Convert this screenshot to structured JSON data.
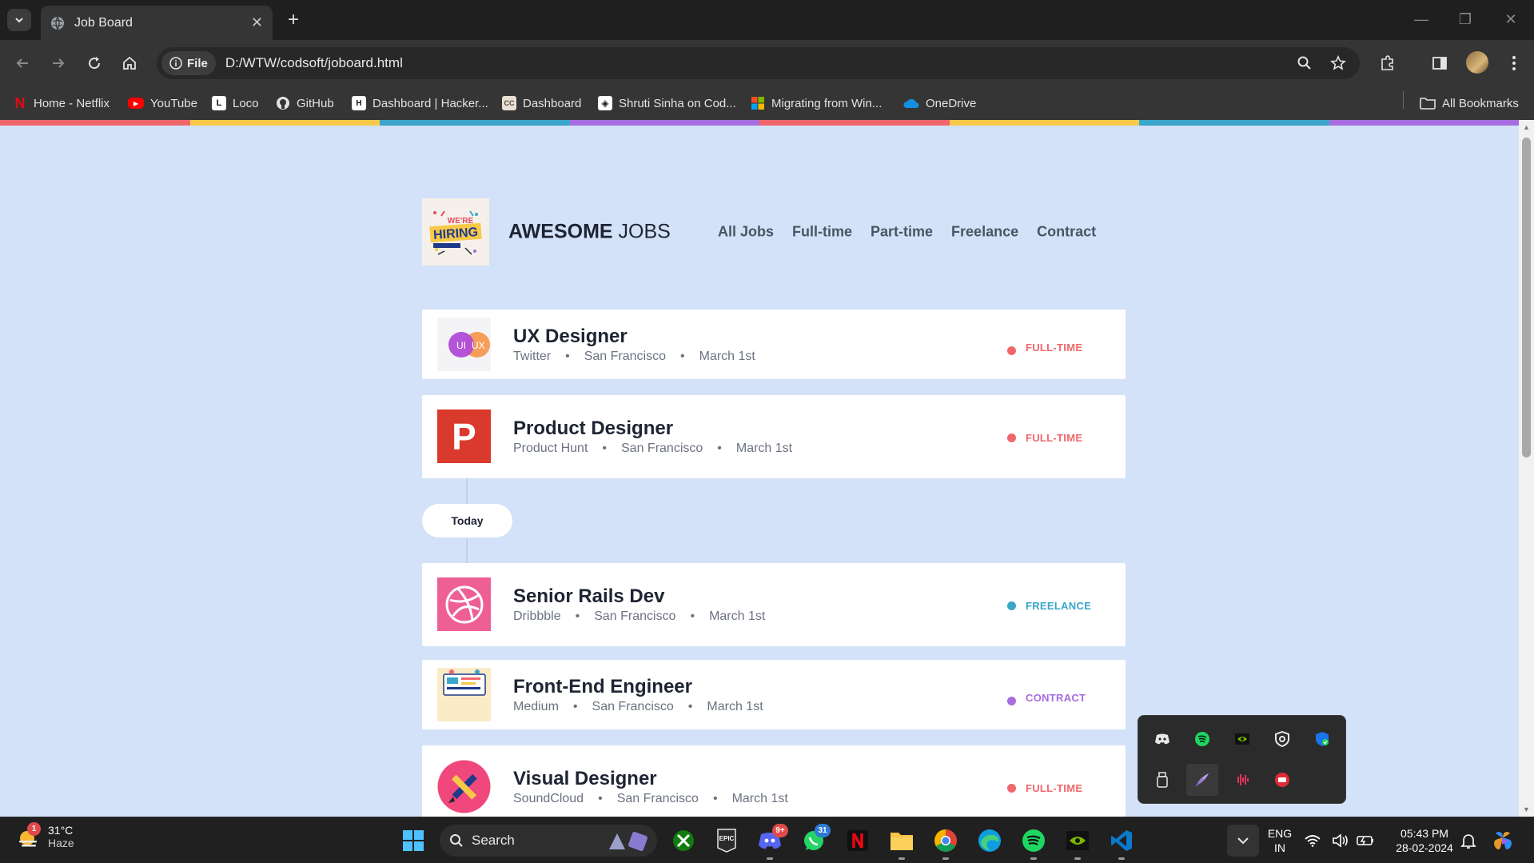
{
  "browser": {
    "tab_title": "Job Board",
    "url_chip": "File",
    "url": "D:/WTW/codsoft/joboard.html",
    "bookmarks": [
      {
        "label": "Home - Netflix",
        "icon": "netflix-icon"
      },
      {
        "label": "YouTube",
        "icon": "youtube-icon"
      },
      {
        "label": "Loco",
        "icon": "loco-icon"
      },
      {
        "label": "GitHub",
        "icon": "github-icon"
      },
      {
        "label": "Dashboard | Hacker...",
        "icon": "hackerrank-icon"
      },
      {
        "label": "Dashboard",
        "icon": "codechef-icon"
      },
      {
        "label": "Shruti Sinha on Cod...",
        "icon": "codepen-icon"
      },
      {
        "label": "Migrating from Win...",
        "icon": "microsoft-icon"
      },
      {
        "label": "OneDrive",
        "icon": "onedrive-icon"
      }
    ],
    "all_bookmarks": "All Bookmarks"
  },
  "site": {
    "brand_bold": "AWESOME",
    "brand_rest": " JOBS",
    "logo_text_top": "WE'RE",
    "logo_text_main": "HIRING",
    "nav": [
      "All Jobs",
      "Full-time",
      "Part-time",
      "Freelance",
      "Contract"
    ],
    "today_label": "Today"
  },
  "jobs": [
    {
      "title": "UX Designer",
      "company": "Twitter",
      "location": "San Francisco",
      "date": "March 1st",
      "type": "FULL-TIME",
      "type_color": "#f0676b",
      "logo_text_a": "UI",
      "logo_text_b": "UX"
    },
    {
      "title": "Product Designer",
      "company": "Product Hunt",
      "location": "San Francisco",
      "date": "March 1st",
      "type": "FULL-TIME",
      "type_color": "#f0676b",
      "logo_text": "P"
    },
    {
      "title": "Senior Rails Dev",
      "company": "Dribbble",
      "location": "San Francisco",
      "date": "March 1st",
      "type": "FREELANCE",
      "type_color": "#3aa6c9"
    },
    {
      "title": "Front-End Engineer",
      "company": "Medium",
      "location": "San Francisco",
      "date": "March 1st",
      "type": "CONTRACT",
      "type_color": "#a66ce0"
    },
    {
      "title": "Visual Designer",
      "company": "SoundCloud",
      "location": "San Francisco",
      "date": "March 1st",
      "type": "FULL-TIME",
      "type_color": "#f0676b"
    }
  ],
  "separator": "•",
  "taskbar": {
    "temperature": "31°C",
    "condition": "Haze",
    "weather_badge": "1",
    "search_label": "Search",
    "discord_badge": "9+",
    "whatsapp_badge": "31",
    "lang_top": "ENG",
    "lang_bottom": "IN",
    "time": "05:43 PM",
    "date": "28-02-2024"
  },
  "colors": {
    "page_bg": "#d3e2f8",
    "rainbow": [
      "#f0676b",
      "#f7c948",
      "#3aa6c9",
      "#a66ce0",
      "#f0676b",
      "#f7c948",
      "#3aa6c9",
      "#a66ce0"
    ]
  }
}
